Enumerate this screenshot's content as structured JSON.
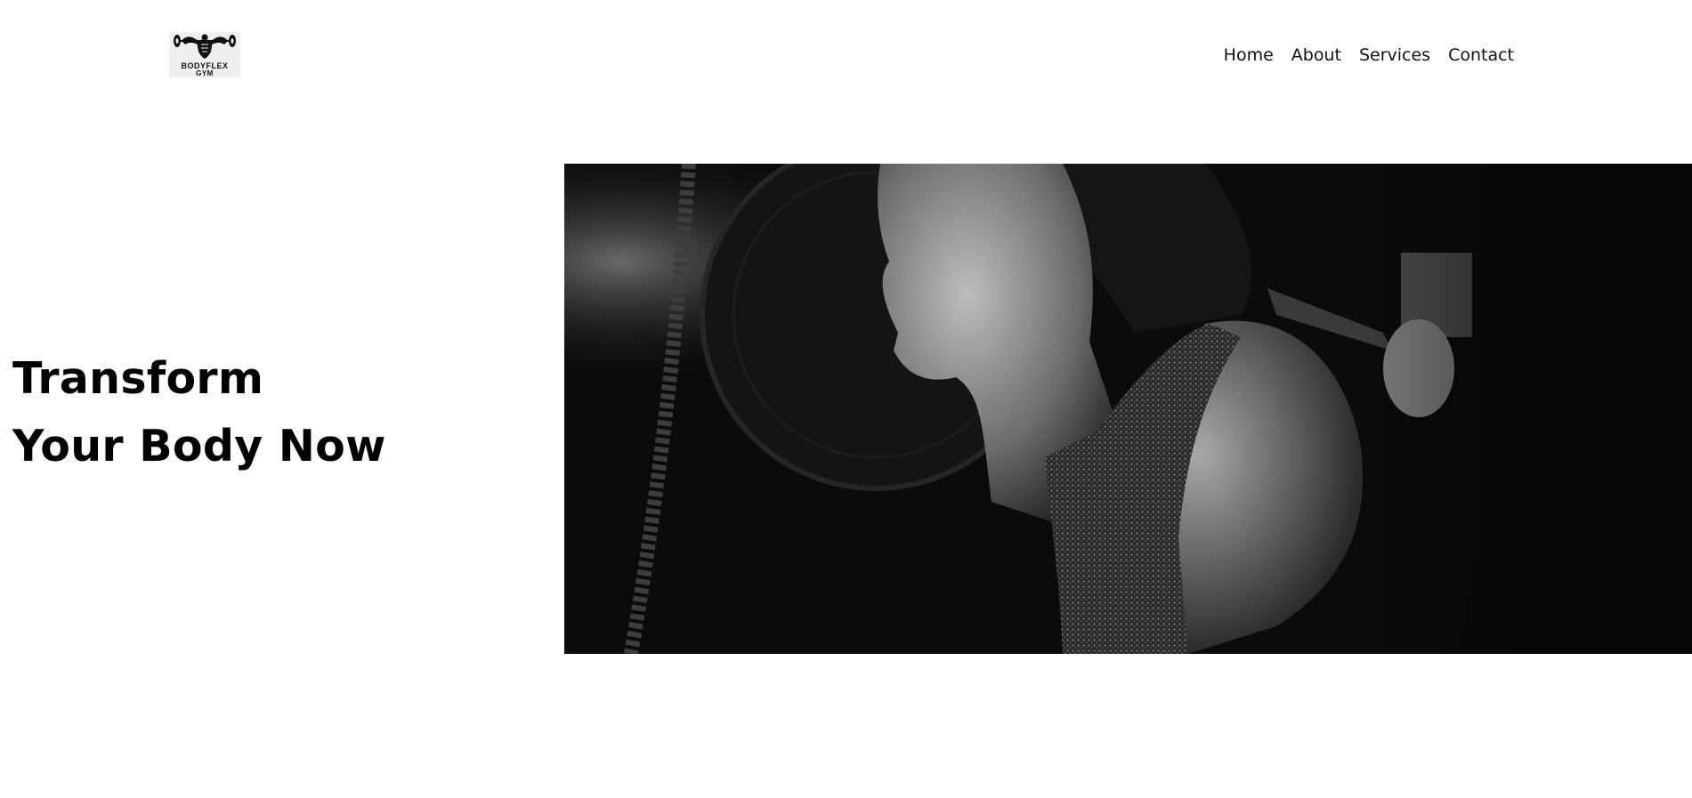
{
  "brand": {
    "logo_line1": "BODYFLEX",
    "logo_line2": "GYM"
  },
  "nav": {
    "items": [
      "Home",
      "About",
      "Services",
      "Contact"
    ]
  },
  "hero": {
    "headline_line1": "Transform",
    "headline_line2": "Your Body Now",
    "image_description": "black-and-white-woman-with-barbell-photo"
  },
  "colors": {
    "background": "#ffffff",
    "text": "#000000",
    "image_tone": "#0a0a0a"
  }
}
